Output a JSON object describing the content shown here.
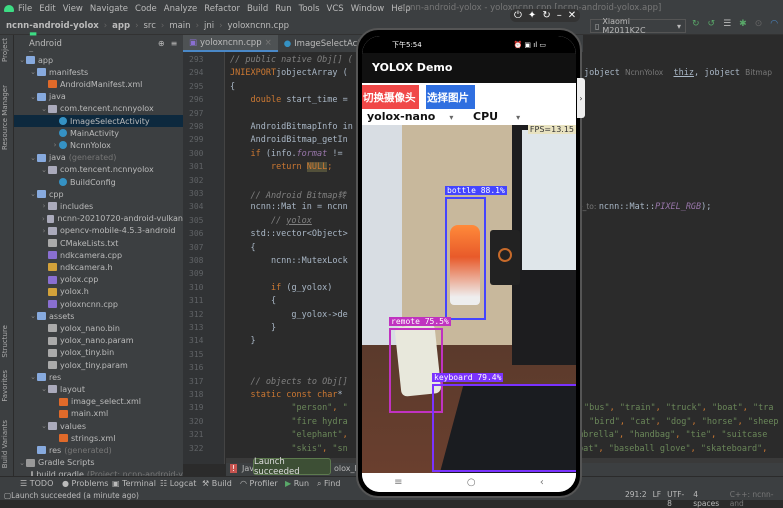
{
  "menu": {
    "items": [
      "File",
      "Edit",
      "View",
      "Navigate",
      "Code",
      "Analyze",
      "Refactor",
      "Build",
      "Run",
      "Tools",
      "VCS",
      "Window",
      "Help"
    ],
    "window_title": "ncnn-android-yolox - yoloxncnn.cpp [ncnn-android-yolox.app]"
  },
  "breadcrumb": [
    "ncnn-android-yolox",
    "app",
    "src",
    "main",
    "jni",
    "yoloxncnn.cpp"
  ],
  "device": {
    "name": "Xiaomi M2011K2C"
  },
  "side_tools": {
    "project": "Project",
    "resource": "Resource Manager",
    "structure": "Structure",
    "favorites": "Favorites",
    "build_variants": "Build Variants"
  },
  "project_view": {
    "mode": "Android"
  },
  "tree": [
    {
      "label": "app",
      "depth": 0,
      "arrow": "v",
      "icon": "folder"
    },
    {
      "label": "manifests",
      "depth": 1,
      "arrow": "v",
      "icon": "folder"
    },
    {
      "label": "AndroidManifest.xml",
      "depth": 2,
      "arrow": "",
      "icon": "xml"
    },
    {
      "label": "java",
      "depth": 1,
      "arrow": "v",
      "icon": "folder"
    },
    {
      "label": "com.tencent.ncnnyolox",
      "depth": 2,
      "arrow": "v",
      "icon": "pkg"
    },
    {
      "label": "ImageSelectActivity",
      "depth": 3,
      "arrow": "",
      "icon": "cls",
      "selected": true
    },
    {
      "label": "MainActivity",
      "depth": 3,
      "arrow": "",
      "icon": "cls"
    },
    {
      "label": "NcnnYolox",
      "depth": 3,
      "arrow": ">",
      "icon": "cls"
    },
    {
      "label": "java",
      "gen": "(generated)",
      "depth": 1,
      "arrow": "v",
      "icon": "folder"
    },
    {
      "label": "com.tencent.ncnnyolox",
      "depth": 2,
      "arrow": "v",
      "icon": "pkg"
    },
    {
      "label": "BuildConfig",
      "depth": 3,
      "arrow": "",
      "icon": "cls"
    },
    {
      "label": "cpp",
      "depth": 1,
      "arrow": "v",
      "icon": "folder"
    },
    {
      "label": "includes",
      "depth": 2,
      "arrow": ">",
      "icon": "pkg"
    },
    {
      "label": "ncnn-20210720-android-vulkan",
      "depth": 2,
      "arrow": ">",
      "icon": "pkg"
    },
    {
      "label": "opencv-mobile-4.5.3-android",
      "depth": 2,
      "arrow": ">",
      "icon": "pkg"
    },
    {
      "label": "CMakeLists.txt",
      "depth": 2,
      "arrow": "",
      "icon": "txt"
    },
    {
      "label": "ndkcamera.cpp",
      "depth": 2,
      "arrow": "",
      "icon": "file"
    },
    {
      "label": "ndkcamera.h",
      "depth": 2,
      "arrow": "",
      "icon": "h"
    },
    {
      "label": "yolox.cpp",
      "depth": 2,
      "arrow": "",
      "icon": "file"
    },
    {
      "label": "yolox.h",
      "depth": 2,
      "arrow": "",
      "icon": "h"
    },
    {
      "label": "yoloxncnn.cpp",
      "depth": 2,
      "arrow": "",
      "icon": "file"
    },
    {
      "label": "assets",
      "depth": 1,
      "arrow": "v",
      "icon": "folder"
    },
    {
      "label": "yolox_nano.bin",
      "depth": 2,
      "arrow": "",
      "icon": "txt"
    },
    {
      "label": "yolox_nano.param",
      "depth": 2,
      "arrow": "",
      "icon": "txt"
    },
    {
      "label": "yolox_tiny.bin",
      "depth": 2,
      "arrow": "",
      "icon": "txt"
    },
    {
      "label": "yolox_tiny.param",
      "depth": 2,
      "arrow": "",
      "icon": "txt"
    },
    {
      "label": "res",
      "depth": 1,
      "arrow": "v",
      "icon": "folder"
    },
    {
      "label": "layout",
      "depth": 2,
      "arrow": "v",
      "icon": "pkg"
    },
    {
      "label": "image_select.xml",
      "depth": 3,
      "arrow": "",
      "icon": "xml"
    },
    {
      "label": "main.xml",
      "depth": 3,
      "arrow": "",
      "icon": "xml"
    },
    {
      "label": "values",
      "depth": 2,
      "arrow": "v",
      "icon": "pkg"
    },
    {
      "label": "strings.xml",
      "depth": 3,
      "arrow": "",
      "icon": "xml"
    },
    {
      "label": "res",
      "gen": "(generated)",
      "depth": 1,
      "arrow": "",
      "icon": "folder"
    },
    {
      "label": "Gradle Scripts",
      "depth": 0,
      "arrow": "v",
      "icon": "gradle"
    },
    {
      "label": "build.gradle",
      "gen": "(Project: ncnn-android-y",
      "depth": 1,
      "arrow": "",
      "icon": "gradle"
    }
  ],
  "editor_tabs": [
    {
      "label": "yoloxncnn.cpp",
      "active": true
    },
    {
      "label": "ImageSelectActivity",
      "active": false
    }
  ],
  "code": [
    {
      "n": 293,
      "t": [
        [
          "c",
          "// public native Obj[] ("
        ]
      ]
    },
    {
      "n": 294,
      "t": [
        [
          "k",
          "JNIEXPORT"
        ],
        [
          "",
          "jobjectArray ("
        ]
      ],
      "tail": [
        [
          "",
          "jobject "
        ],
        [
          "h",
          "NcnnYolox"
        ],
        [
          "",
          "  "
        ],
        [
          "u",
          "thiz"
        ],
        [
          "",
          ", jobject "
        ],
        [
          "h",
          "Bitmap"
        ]
      ]
    },
    {
      "n": 295,
      "t": [
        [
          "",
          "{"
        ]
      ]
    },
    {
      "n": 296,
      "t": [
        [
          "",
          "    "
        ],
        [
          "k",
          "double"
        ],
        [
          "",
          " start_time = "
        ]
      ]
    },
    {
      "n": 297,
      "t": []
    },
    {
      "n": 298,
      "t": [
        [
          "",
          "    AndroidBitmapInfo in"
        ]
      ]
    },
    {
      "n": 299,
      "t": [
        [
          "",
          "    AndroidBitmap_getIn"
        ]
      ]
    },
    {
      "n": 300,
      "t": [
        [
          "",
          "    "
        ],
        [
          "k",
          "if"
        ],
        [
          "",
          " (info."
        ],
        [
          "p",
          "format"
        ],
        [
          "",
          " != "
        ]
      ]
    },
    {
      "n": 301,
      "t": [
        [
          "",
          "        "
        ],
        [
          "k",
          "return"
        ],
        [
          "",
          " "
        ],
        [
          "n",
          "NULL"
        ],
        [
          "k",
          ";"
        ]
      ]
    },
    {
      "n": 302,
      "t": []
    },
    {
      "n": 303,
      "t": [
        [
          "c",
          "    // Android Bitmap转"
        ]
      ]
    },
    {
      "n": 304,
      "t": [
        [
          "",
          "    ncnn::Mat in = ncnn"
        ]
      ],
      "tail": [
        [
          "h",
          "e_to: "
        ],
        [
          "",
          "ncnn::Mat::"
        ],
        [
          "p",
          "PIXEL_RGB"
        ],
        [
          "",
          ");"
        ]
      ]
    },
    {
      "n": 305,
      "t": [
        [
          "c",
          "        // "
        ],
        [
          "c u",
          "yolox"
        ]
      ]
    },
    {
      "n": 306,
      "t": [
        [
          "",
          "    std::vector<Object> "
        ]
      ]
    },
    {
      "n": 307,
      "t": [
        [
          "",
          "    {"
        ]
      ]
    },
    {
      "n": 308,
      "t": [
        [
          "",
          "        ncnn::MutexLock"
        ]
      ]
    },
    {
      "n": 309,
      "t": []
    },
    {
      "n": 310,
      "t": [
        [
          "",
          "        "
        ],
        [
          "k",
          "if"
        ],
        [
          "",
          " (g_yolox)"
        ]
      ]
    },
    {
      "n": 311,
      "t": [
        [
          "",
          "        {"
        ]
      ]
    },
    {
      "n": 312,
      "t": [
        [
          "",
          "            g_yolox->de"
        ]
      ]
    },
    {
      "n": 313,
      "t": [
        [
          "",
          "        }"
        ]
      ]
    },
    {
      "n": 314,
      "t": [
        [
          "",
          "    }"
        ]
      ]
    },
    {
      "n": 315,
      "t": []
    },
    {
      "n": 316,
      "t": []
    },
    {
      "n": 317,
      "t": [
        [
          "c",
          "    // objects to Obj[]"
        ]
      ]
    },
    {
      "n": 318,
      "t": [
        [
          "",
          "    "
        ],
        [
          "k",
          "static const char"
        ],
        [
          "",
          "* "
        ]
      ]
    },
    {
      "n": 319,
      "t": [
        [
          "",
          "            "
        ],
        [
          "s",
          "\"person\""
        ],
        [
          "k",
          ", "
        ],
        [
          "s",
          "\""
        ]
      ],
      "tail": [
        [
          "s",
          "\"bus\""
        ],
        [
          "k",
          ", "
        ],
        [
          "s",
          "\"train\""
        ],
        [
          "k",
          ", "
        ],
        [
          "s",
          "\"truck\""
        ],
        [
          "k",
          ", "
        ],
        [
          "s",
          "\"boat\""
        ],
        [
          "k",
          ", "
        ],
        [
          "s",
          "\"tra"
        ]
      ]
    },
    {
      "n": 320,
      "t": [
        [
          "",
          "            "
        ],
        [
          "s",
          "\"fire hydra"
        ]
      ],
      "tail": [
        [
          "s",
          " \"bird\""
        ],
        [
          "k",
          ", "
        ],
        [
          "s",
          "\"cat\""
        ],
        [
          "k",
          ", "
        ],
        [
          "s",
          "\"dog\""
        ],
        [
          "k",
          ", "
        ],
        [
          "s",
          "\"horse\""
        ],
        [
          "k",
          ", "
        ],
        [
          "s",
          "\"sheep"
        ]
      ]
    },
    {
      "n": 321,
      "t": [
        [
          "",
          "            "
        ],
        [
          "s",
          "\"elephant\""
        ],
        [
          "k",
          ", "
        ]
      ],
      "tail": [
        [
          "s",
          "mbrella\""
        ],
        [
          "k",
          ", "
        ],
        [
          "s",
          "\"handbag\""
        ],
        [
          "k",
          ", "
        ],
        [
          "s",
          "\"tie\""
        ],
        [
          "k",
          ", "
        ],
        [
          "s",
          "\"suitcase"
        ]
      ]
    },
    {
      "n": 322,
      "t": [
        [
          "",
          "            "
        ],
        [
          "s",
          "\"skis\""
        ],
        [
          "k",
          ", "
        ],
        [
          "s",
          "\"sn"
        ]
      ],
      "tail": [
        [
          "s",
          "bat\""
        ],
        [
          "k",
          ", "
        ],
        [
          "s",
          "\"baseball glove\""
        ],
        [
          "k",
          ", "
        ],
        [
          "s",
          "\"skateboard\""
        ],
        [
          "k",
          ","
        ]
      ]
    }
  ],
  "bottom_tools": [
    "TODO",
    "Problems",
    "Terminal",
    "Logcat",
    "Build",
    "Profiler",
    "Run",
    "Find"
  ],
  "editor_bottom_tab": "Jav",
  "editor_bottom_tab2": "olox_N",
  "tooltip": "Launch succeeded",
  "status": {
    "message": "Launch succeeded (a minute ago)",
    "position": "291:2",
    "line_sep": "LF",
    "encoding": "UTF-8",
    "indent": "4 spaces",
    "context": "C++: ncnn-and"
  },
  "phone": {
    "time": "下午5:54",
    "app_title": "YOLOX Demo",
    "btn_camera": "切换摄像头",
    "btn_camera_color": "#f04848",
    "btn_pick": "选择图片",
    "btn_pick_color": "#2f6fe0",
    "model": "yolox-nano",
    "device": "CPU",
    "fps": "FPS=13.15",
    "detections": [
      {
        "label": "bottle 88.1%",
        "color": "#4444ff"
      },
      {
        "label": "remote 75.5%",
        "color": "#c032c0"
      },
      {
        "label": "keyboard 79.4%",
        "color": "#7a32ff"
      }
    ]
  }
}
